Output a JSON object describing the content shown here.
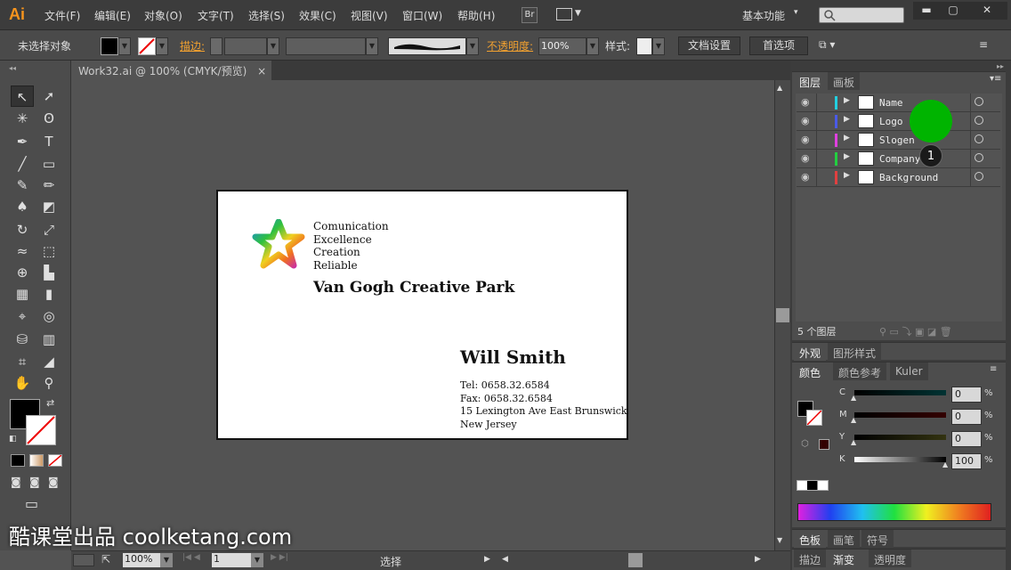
{
  "menubar": {
    "logo": "Ai",
    "items": [
      "文件(F)",
      "编辑(E)",
      "对象(O)",
      "文字(T)",
      "选择(S)",
      "效果(C)",
      "视图(V)",
      "窗口(W)",
      "帮助(H)"
    ],
    "bridge": "Br",
    "workspace": "基本功能",
    "workspace_caret": "▾",
    "win_min": "▬",
    "win_max": "▢",
    "win_close": "✕"
  },
  "control": {
    "selection": "未选择对象",
    "stroke_label": "描边:",
    "opacity_label": "不透明度:",
    "opacity_value": "100%",
    "style_label": "样式:",
    "doc_setup": "文档设置",
    "preferences": "首选项"
  },
  "document": {
    "tab_title": "Work32.ai @ 100% (CMYK/预览)",
    "tab_close": "×"
  },
  "card": {
    "tags": [
      "Comunication",
      "Excellence",
      "Creation",
      "Reliable"
    ],
    "company": "Van Gogh Creative Park",
    "person": "Will Smith",
    "tel": "Tel: 0658.32.6584",
    "fax": "Fax: 0658.32.6584",
    "address": "15 Lexington Ave East Brunswick",
    "city": "New Jersey"
  },
  "status": {
    "zoom": "100%",
    "page": "1",
    "tool": "选择"
  },
  "layers_panel": {
    "tabs": [
      "图层",
      "画板"
    ],
    "layers": [
      {
        "name": "Name",
        "color": "#22d0e0"
      },
      {
        "name": "Logo",
        "color": "#4a5ae8"
      },
      {
        "name": "Slogen",
        "color": "#e040e0"
      },
      {
        "name": "Company",
        "color": "#22d040"
      },
      {
        "name": "Background",
        "color": "#e04040"
      }
    ],
    "count": "5 个图层",
    "badge": "1",
    "highlight_color": "#00b400"
  },
  "appearance_panel": {
    "tabs": [
      "外观",
      "图形样式"
    ]
  },
  "color_panel": {
    "tabs": [
      "颜色",
      "颜色参考",
      "Kuler"
    ],
    "channels": [
      {
        "label": "C",
        "value": "0",
        "unit": "%"
      },
      {
        "label": "M",
        "value": "0",
        "unit": "%"
      },
      {
        "label": "Y",
        "value": "0",
        "unit": "%"
      },
      {
        "label": "K",
        "value": "100",
        "unit": "%"
      }
    ]
  },
  "swatch_panel": {
    "tabs": [
      "色板",
      "画笔",
      "符号"
    ]
  },
  "stroke_panel": {
    "tabs": [
      "描边",
      "渐变",
      "透明度"
    ]
  },
  "watermark": "酷课堂出品 coolketang.com"
}
